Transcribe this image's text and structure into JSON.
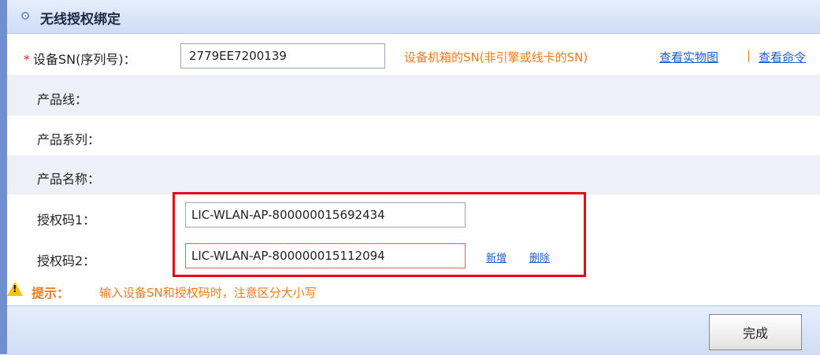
{
  "header": {
    "title": "无线授权绑定"
  },
  "sn": {
    "label": "设备SN(序列号)：",
    "required_mark": "*",
    "value": "2779EE7200139",
    "hint": "设备机箱的SN(非引擎或线卡的SN)",
    "link_photo": "查看实物图",
    "separator": "|",
    "link_command": "查看命令"
  },
  "fields": {
    "product_line": "产品线：",
    "product_series": "产品系列：",
    "product_name": "产品名称："
  },
  "auth": {
    "label1": "授权码1：",
    "value1": "LIC-WLAN-AP-800000015692434",
    "label2": "授权码2：",
    "value2": "LIC-WLAN-AP-800000015112094",
    "add_label": "新增",
    "delete_label": "删除"
  },
  "tip": {
    "label": "提示：",
    "text": "输入设备SN和授权码时，注意区分大小写"
  },
  "footer": {
    "done_label": "完成"
  },
  "colors": {
    "accent_blue": "#6f8fd1",
    "hint_orange": "#f07b1c",
    "highlight_red": "#e30b15",
    "link_blue": "#1f5ec9"
  }
}
